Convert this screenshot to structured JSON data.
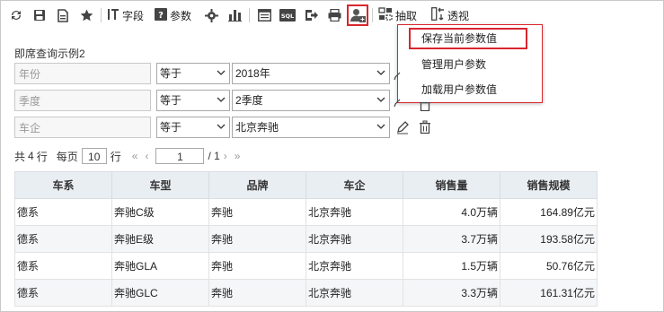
{
  "toolbar": {
    "field_label": "字段",
    "param_label": "参数",
    "extract_label": "抽取",
    "pivot_label": "透视"
  },
  "user_param_menu": {
    "items": [
      "保存当前参数值",
      "管理用户参数",
      "加载用户参数值"
    ]
  },
  "query": {
    "title": "即席查询示例2",
    "params": [
      {
        "name": "年份",
        "operator": "等于",
        "value": "2018年"
      },
      {
        "name": "季度",
        "operator": "等于",
        "value": "2季度"
      },
      {
        "name": "车企",
        "operator": "等于",
        "value": "北京奔驰"
      }
    ]
  },
  "pager": {
    "total_prefix": "共",
    "total_rows": "4",
    "total_suffix": "行",
    "per_page_label": "每页",
    "per_page": "10",
    "rows_unit": "行",
    "current_page": "1",
    "total_pages": "/ 1"
  },
  "table": {
    "headers": [
      "车系",
      "车型",
      "品牌",
      "车企",
      "销售量",
      "销售规模"
    ],
    "rows": [
      [
        "德系",
        "奔驰C级",
        "奔驰",
        "北京奔驰",
        "4.0万辆",
        "164.89亿元"
      ],
      [
        "德系",
        "奔驰E级",
        "奔驰",
        "北京奔驰",
        "3.7万辆",
        "193.58亿元"
      ],
      [
        "德系",
        "奔驰GLA",
        "奔驰",
        "北京奔驰",
        "1.5万辆",
        "50.76亿元"
      ],
      [
        "德系",
        "奔驰GLC",
        "奔驰",
        "北京奔驰",
        "3.3万辆",
        "161.31亿元"
      ]
    ]
  }
}
